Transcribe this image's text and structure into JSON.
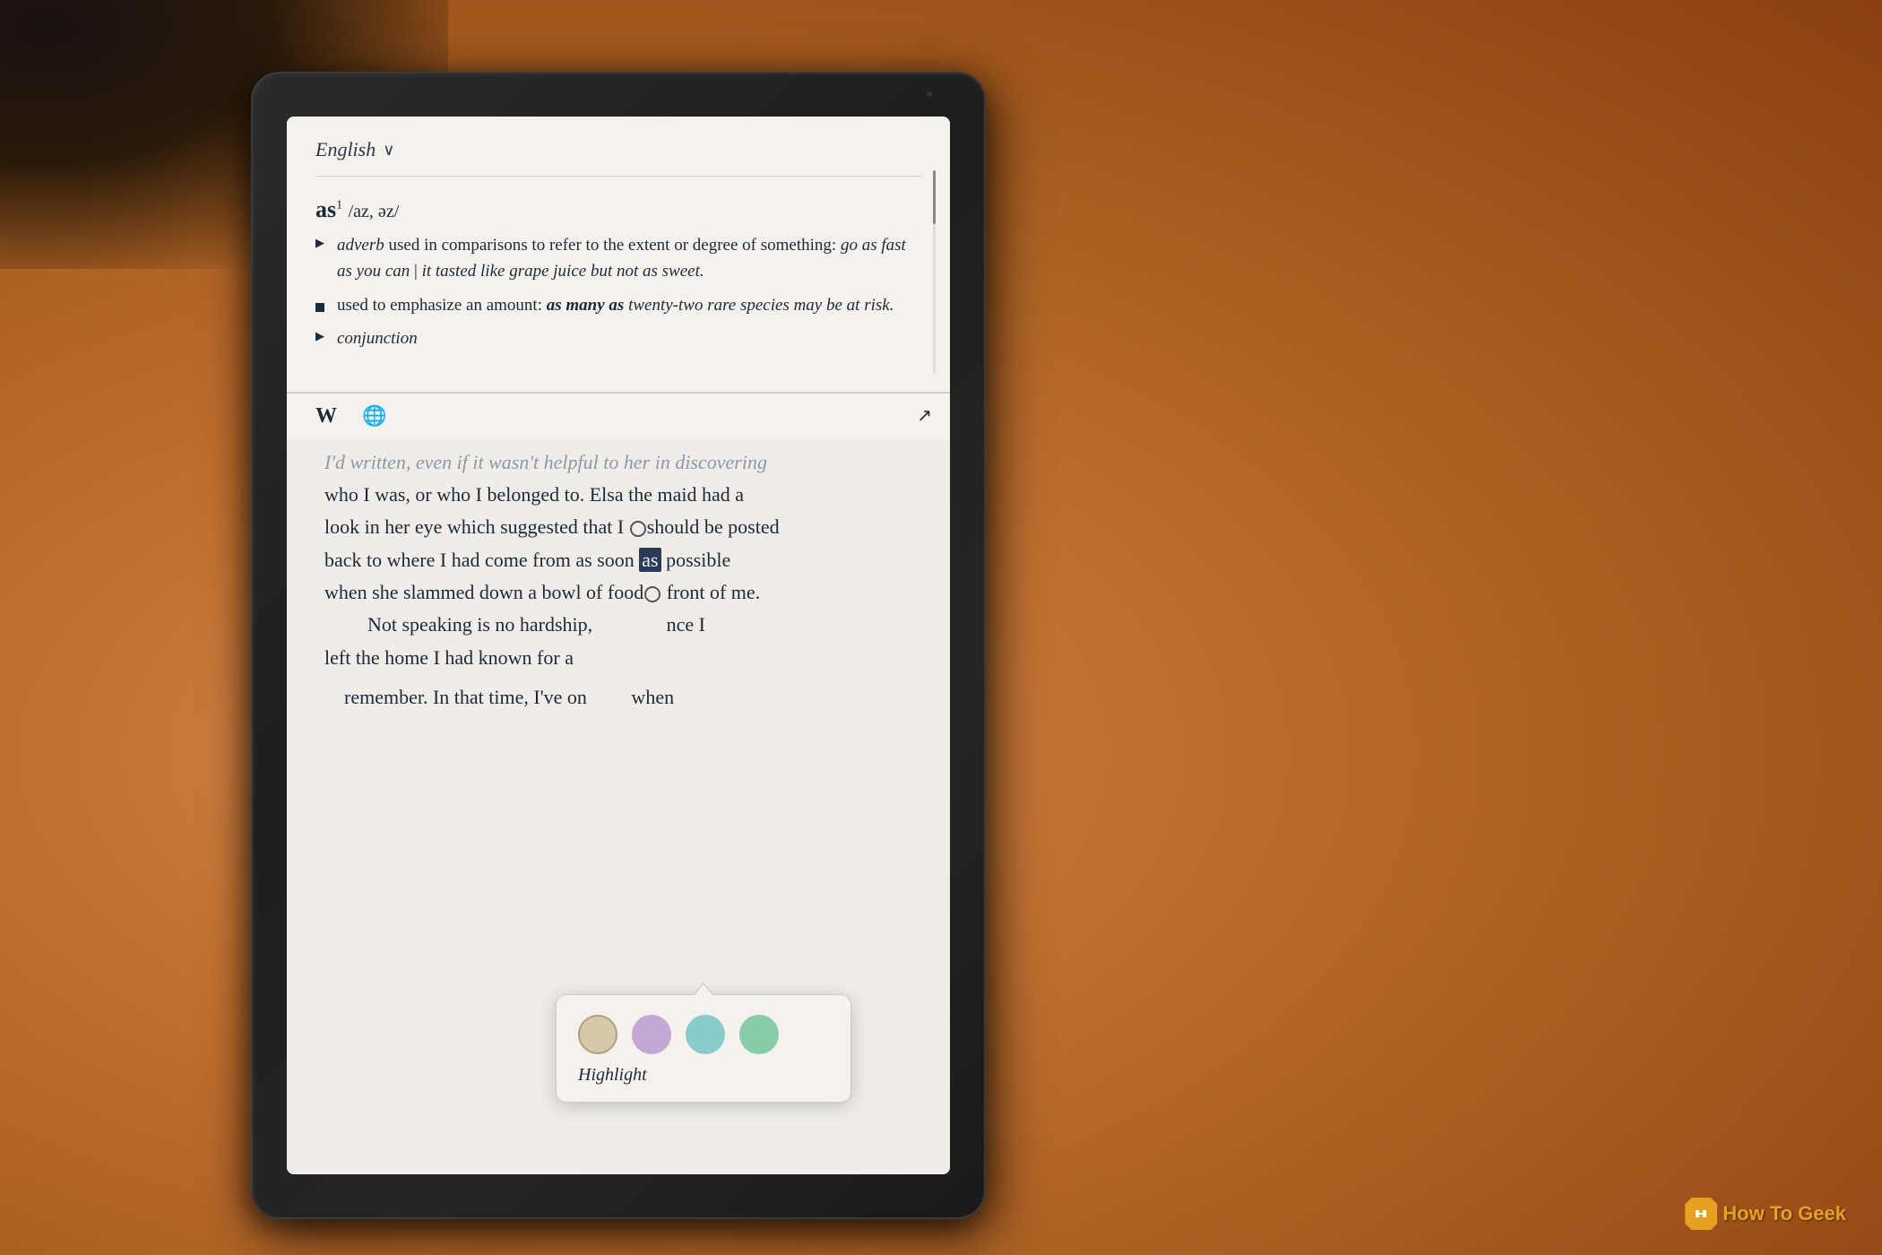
{
  "background": {
    "color": "#c47a3a"
  },
  "kindle": {
    "camera_dot": true,
    "dictionary": {
      "language_selector": {
        "label": "English",
        "arrow": "∨"
      },
      "headword": "as",
      "superscript": "1",
      "pronunciation": "/az, əz/",
      "definitions": [
        {
          "bullet_type": "triangle",
          "text_parts": [
            {
              "type": "italic",
              "text": "adverb"
            },
            {
              "type": "normal",
              "text": " used in comparisons to refer to the extent or degree of something: "
            },
            {
              "type": "italic",
              "text": "go as fast as you can"
            },
            {
              "type": "normal",
              "text": " | "
            },
            {
              "type": "italic",
              "text": "it tasted like grape juice but not as sweet."
            }
          ]
        },
        {
          "bullet_type": "square",
          "text_parts": [
            {
              "type": "normal",
              "text": "used to emphasize an amount: "
            },
            {
              "type": "bold-italic",
              "text": "as many as"
            },
            {
              "type": "italic",
              "text": " twenty-two rare species may be at risk."
            }
          ]
        },
        {
          "bullet_type": "triangle",
          "text_parts": [
            {
              "type": "italic",
              "text": "conjunction"
            }
          ]
        }
      ]
    },
    "wiki_bar": {
      "w_label": "W",
      "globe_icon": "🌐",
      "expand_icon": "↗"
    },
    "book_text": {
      "lines": [
        "I'd written, even if it wasn't helpful to her in discovering",
        "who I was, or who I belonged to. Elsa the maid had a",
        "look in her eye which suggested that I should be posted",
        "back to where I had come from as soon as possible",
        "when she slammed down a bowl of food front of me.",
        "    Not speaking is no hardship, nce I",
        "left the home I had known for a",
        "    remember. In that time, I've on when"
      ],
      "highlighted_word": "as",
      "highlight_popup": {
        "colors": [
          {
            "name": "yellow",
            "label": "Yellow"
          },
          {
            "name": "purple",
            "label": "Purple"
          },
          {
            "name": "blue",
            "label": "Blue"
          },
          {
            "name": "green",
            "label": "Green"
          }
        ],
        "label": "Highlight"
      }
    }
  },
  "watermark": {
    "logo_text": "How-To Geek",
    "display_text": "How To Geek"
  }
}
